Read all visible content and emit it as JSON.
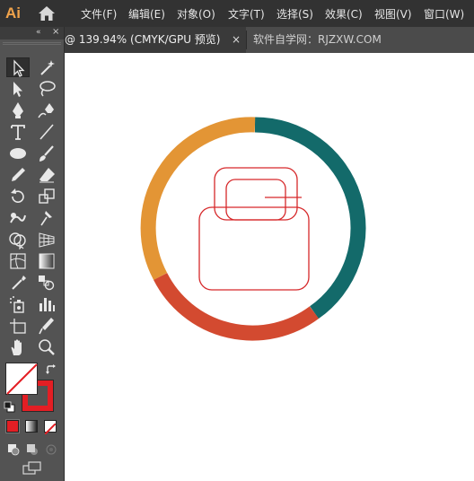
{
  "app": {
    "logo_text": "Ai",
    "logo_color": "#f0a34b"
  },
  "menu": {
    "items": [
      {
        "label": "文件(F)"
      },
      {
        "label": "编辑(E)"
      },
      {
        "label": "对象(O)"
      },
      {
        "label": "文字(T)"
      },
      {
        "label": "选择(S)"
      },
      {
        "label": "效果(C)"
      },
      {
        "label": "视图(V)"
      },
      {
        "label": "窗口(W)"
      }
    ]
  },
  "tabs": {
    "active_label": "@ 139.94% (CMYK/GPU 预览)",
    "close_glyph": "×",
    "inactive_label": "软件自学网：RJZXW.COM"
  },
  "toolbar": {
    "collapse_glyph": "«",
    "close_glyph": "×",
    "tools": [
      "selection-tool",
      "magic-wand-tool",
      "direct-selection-tool",
      "lasso-tool",
      "pen-tool",
      "curvature-tool",
      "type-tool",
      "line-segment-tool",
      "ellipse-tool",
      "paintbrush-tool",
      "pencil-tool",
      "eraser-tool",
      "rotate-tool",
      "scale-tool",
      "warp-tool",
      "puppet-warp-tool",
      "shape-builder-tool",
      "perspective-grid-tool",
      "mesh-tool",
      "gradient-tool",
      "eyedropper-tool",
      "blend-tool",
      "symbol-sprayer-tool",
      "column-graph-tool",
      "artboard-tool",
      "slice-tool",
      "hand-tool",
      "zoom-tool"
    ],
    "fill_color": "#ffffff",
    "stroke_color": "#e31e24",
    "mode_icons": [
      "color-mode-icon",
      "gradient-mode-icon",
      "none-mode-icon"
    ],
    "draw_modes": [
      "draw-normal-icon",
      "draw-behind-icon",
      "draw-inside-icon"
    ],
    "screen_mode_icon": "screen-mode-icon"
  },
  "artwork": {
    "ring_colors": {
      "teal": "#136a6a",
      "orange": "#e39535",
      "red": "#d34a30"
    },
    "icon_stroke": "#d6282a"
  }
}
